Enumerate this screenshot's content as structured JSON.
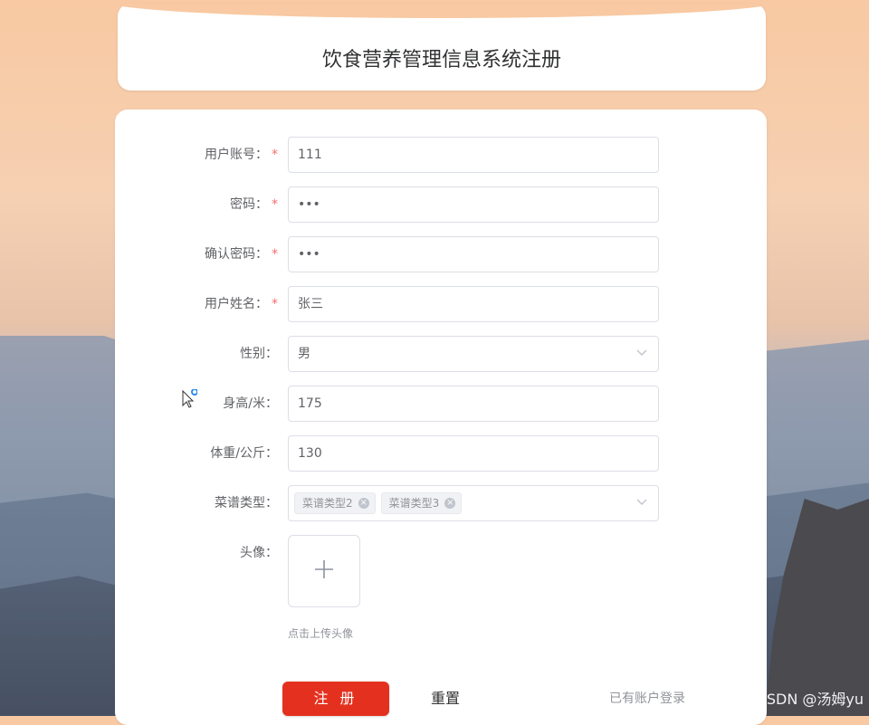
{
  "header": {
    "title": "饮食营养管理信息系统注册"
  },
  "form": {
    "fields": [
      {
        "label": "用户账号：",
        "required": true,
        "value": "111",
        "type": "input"
      },
      {
        "label": "密码：",
        "required": true,
        "value": "•••",
        "type": "password"
      },
      {
        "label": "确认密码：",
        "required": true,
        "value": "•••",
        "type": "password"
      },
      {
        "label": "用户姓名：",
        "required": true,
        "value": "张三",
        "type": "input"
      },
      {
        "label": "性别：",
        "required": false,
        "value": "男",
        "type": "select"
      },
      {
        "label": "身高/米：",
        "required": false,
        "value": "175",
        "type": "input"
      },
      {
        "label": "体重/公斤：",
        "required": false,
        "value": "130",
        "type": "input"
      },
      {
        "label": "菜谱类型：",
        "required": false,
        "type": "multiselect",
        "tags": [
          "菜谱类型2",
          "菜谱类型3"
        ]
      },
      {
        "label": "头像：",
        "required": false,
        "type": "upload"
      }
    ],
    "upload_tip": "点击上传头像",
    "required_mark": "*"
  },
  "actions": {
    "register_label": "注 册",
    "reset_label": "重置",
    "login_link_label": "已有账户登录"
  },
  "watermark": "CSDN @汤姆yu",
  "colors": {
    "primary_button": "#e4311f",
    "required_star": "#f56c6c"
  }
}
